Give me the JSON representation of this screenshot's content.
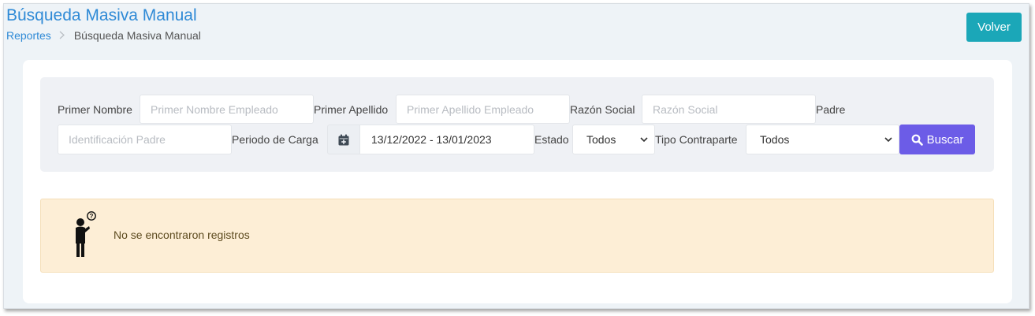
{
  "header": {
    "title": "Búsqueda Masiva Manual",
    "back_label": "Volver"
  },
  "breadcrumb": [
    {
      "label": "Reportes"
    },
    {
      "label": "Búsqueda Masiva Manual"
    }
  ],
  "filters": {
    "primer_nombre": {
      "label": "Primer Nombre",
      "value": "",
      "placeholder": "Primer Nombre Empleado"
    },
    "primer_apellido": {
      "label": "Primer Apellido",
      "value": "",
      "placeholder": "Primer Apellido Empleado"
    },
    "razon_social": {
      "label": "Razón Social",
      "value": "",
      "placeholder": "Razón Social"
    },
    "padre": {
      "label": "Padre",
      "value": "",
      "placeholder": "Identificación Padre"
    },
    "periodo_carga": {
      "label": "Periodo de Carga",
      "value": "13/12/2022 - 13/01/2023",
      "icon": "calendar-plus-icon"
    },
    "estado": {
      "label": "Estado",
      "selected": "Todos"
    },
    "tipo_contraparte": {
      "label": "Tipo Contraparte",
      "selected": "Todos"
    },
    "search_label": "Buscar"
  },
  "empty_state": {
    "message": "No se encontraron registros",
    "icon": "confused-person-icon"
  },
  "colors": {
    "title": "#2f8ad6",
    "back_button": "#1ba7b8",
    "search_button": "#6c5ce7",
    "alert_background": "#fdeed6"
  }
}
